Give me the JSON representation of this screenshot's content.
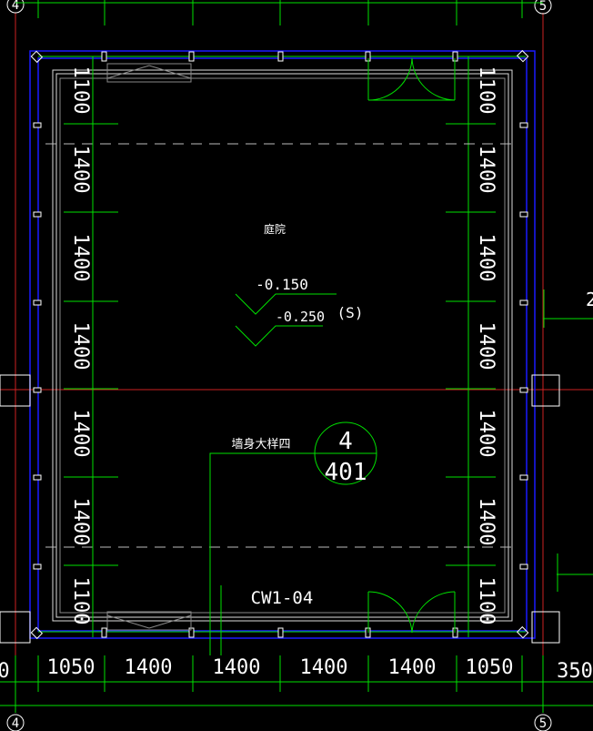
{
  "grid_axes": {
    "left_top": "4",
    "right_top": "5",
    "left_bottom": "4",
    "right_bottom": "5"
  },
  "room_label": "庭院",
  "levels": {
    "level_1": "-0.150",
    "level_2": "-0.250",
    "slope_mark": "(S)"
  },
  "detail_callout": {
    "leader_text": "墙身大样四",
    "detail_number": "4",
    "sheet_number": "401"
  },
  "window_tag": "CW1-04",
  "bottom_dimensions": [
    "1050",
    "1400",
    "1400",
    "1400",
    "1400",
    "1050"
  ],
  "bottom_dim_edge_left": "0",
  "bottom_dim_edge_right": "350",
  "left_dimensions": [
    "1100",
    "1400",
    "1400",
    "1400",
    "1400",
    "1400",
    "1100"
  ],
  "right_dimensions": [
    "1100",
    "1400",
    "1400",
    "1400",
    "1400",
    "1400",
    "1100"
  ],
  "edge_fragment_right": "2",
  "colors": {
    "background": "#000000",
    "axis_red": "#cc2222",
    "dimension_green": "#00e000",
    "wall_blue": "#1a1aff",
    "wall_white": "#ffffff",
    "dashed_grey": "#bbbbbb"
  }
}
